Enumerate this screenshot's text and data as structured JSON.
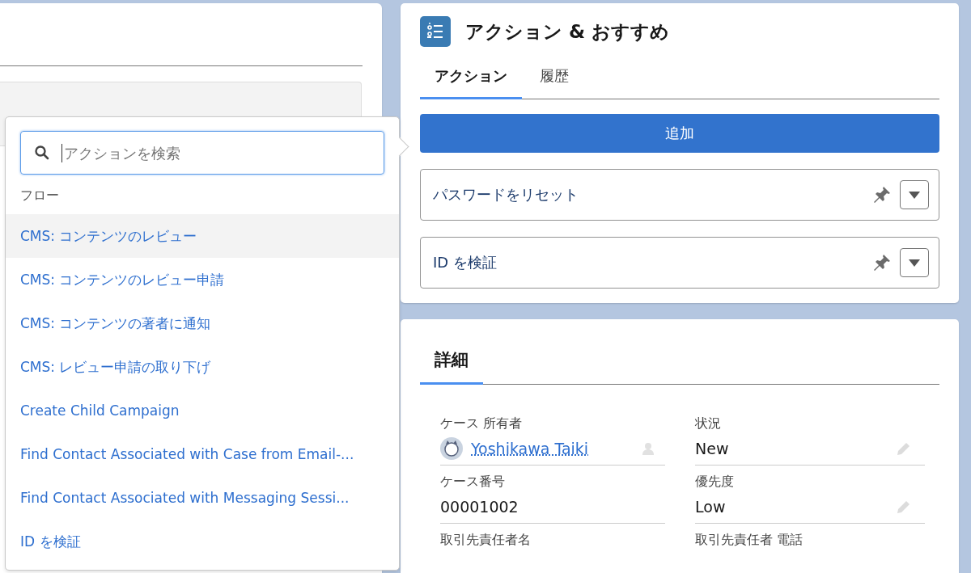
{
  "action_picker": {
    "search": {
      "placeholder": "アクションを検索"
    },
    "section": "フロー",
    "items": [
      {
        "label": "CMS: コンテンツのレビュー",
        "selected": true
      },
      {
        "label": "CMS: コンテンツのレビュー申請",
        "selected": false
      },
      {
        "label": "CMS: コンテンツの著者に通知",
        "selected": false
      },
      {
        "label": "CMS: レビュー申請の取り下げ",
        "selected": false
      },
      {
        "label": "Create Child Campaign",
        "selected": false
      },
      {
        "label": "Find Contact Associated with Case from Email-...",
        "selected": false
      },
      {
        "label": "Find Contact Associated with Messaging Sessi...",
        "selected": false
      },
      {
        "label": "ID を検証",
        "selected": false
      }
    ]
  },
  "actions_panel": {
    "title": "アクション & おすすめ",
    "tabs": [
      {
        "label": "アクション",
        "selected": true
      },
      {
        "label": "履歴",
        "selected": false
      }
    ],
    "add_button": "追加",
    "actions": [
      {
        "label": "パスワードをリセット"
      },
      {
        "label": "ID を検証"
      }
    ]
  },
  "details": {
    "tab": "詳細",
    "fields": [
      {
        "label": "ケース 所有者",
        "value": "Yoshikawa Taiki",
        "kind": "user",
        "editable": false
      },
      {
        "label": "状況",
        "value": "New",
        "kind": "text",
        "editable": true
      },
      {
        "label": "ケース番号",
        "value": "00001002",
        "kind": "text",
        "editable": false
      },
      {
        "label": "優先度",
        "value": "Low",
        "kind": "text",
        "editable": true
      },
      {
        "label": "取引先責任者名",
        "kind": "text",
        "editable": false
      },
      {
        "label": "取引先責任者 電話",
        "kind": "text",
        "editable": false
      }
    ]
  }
}
